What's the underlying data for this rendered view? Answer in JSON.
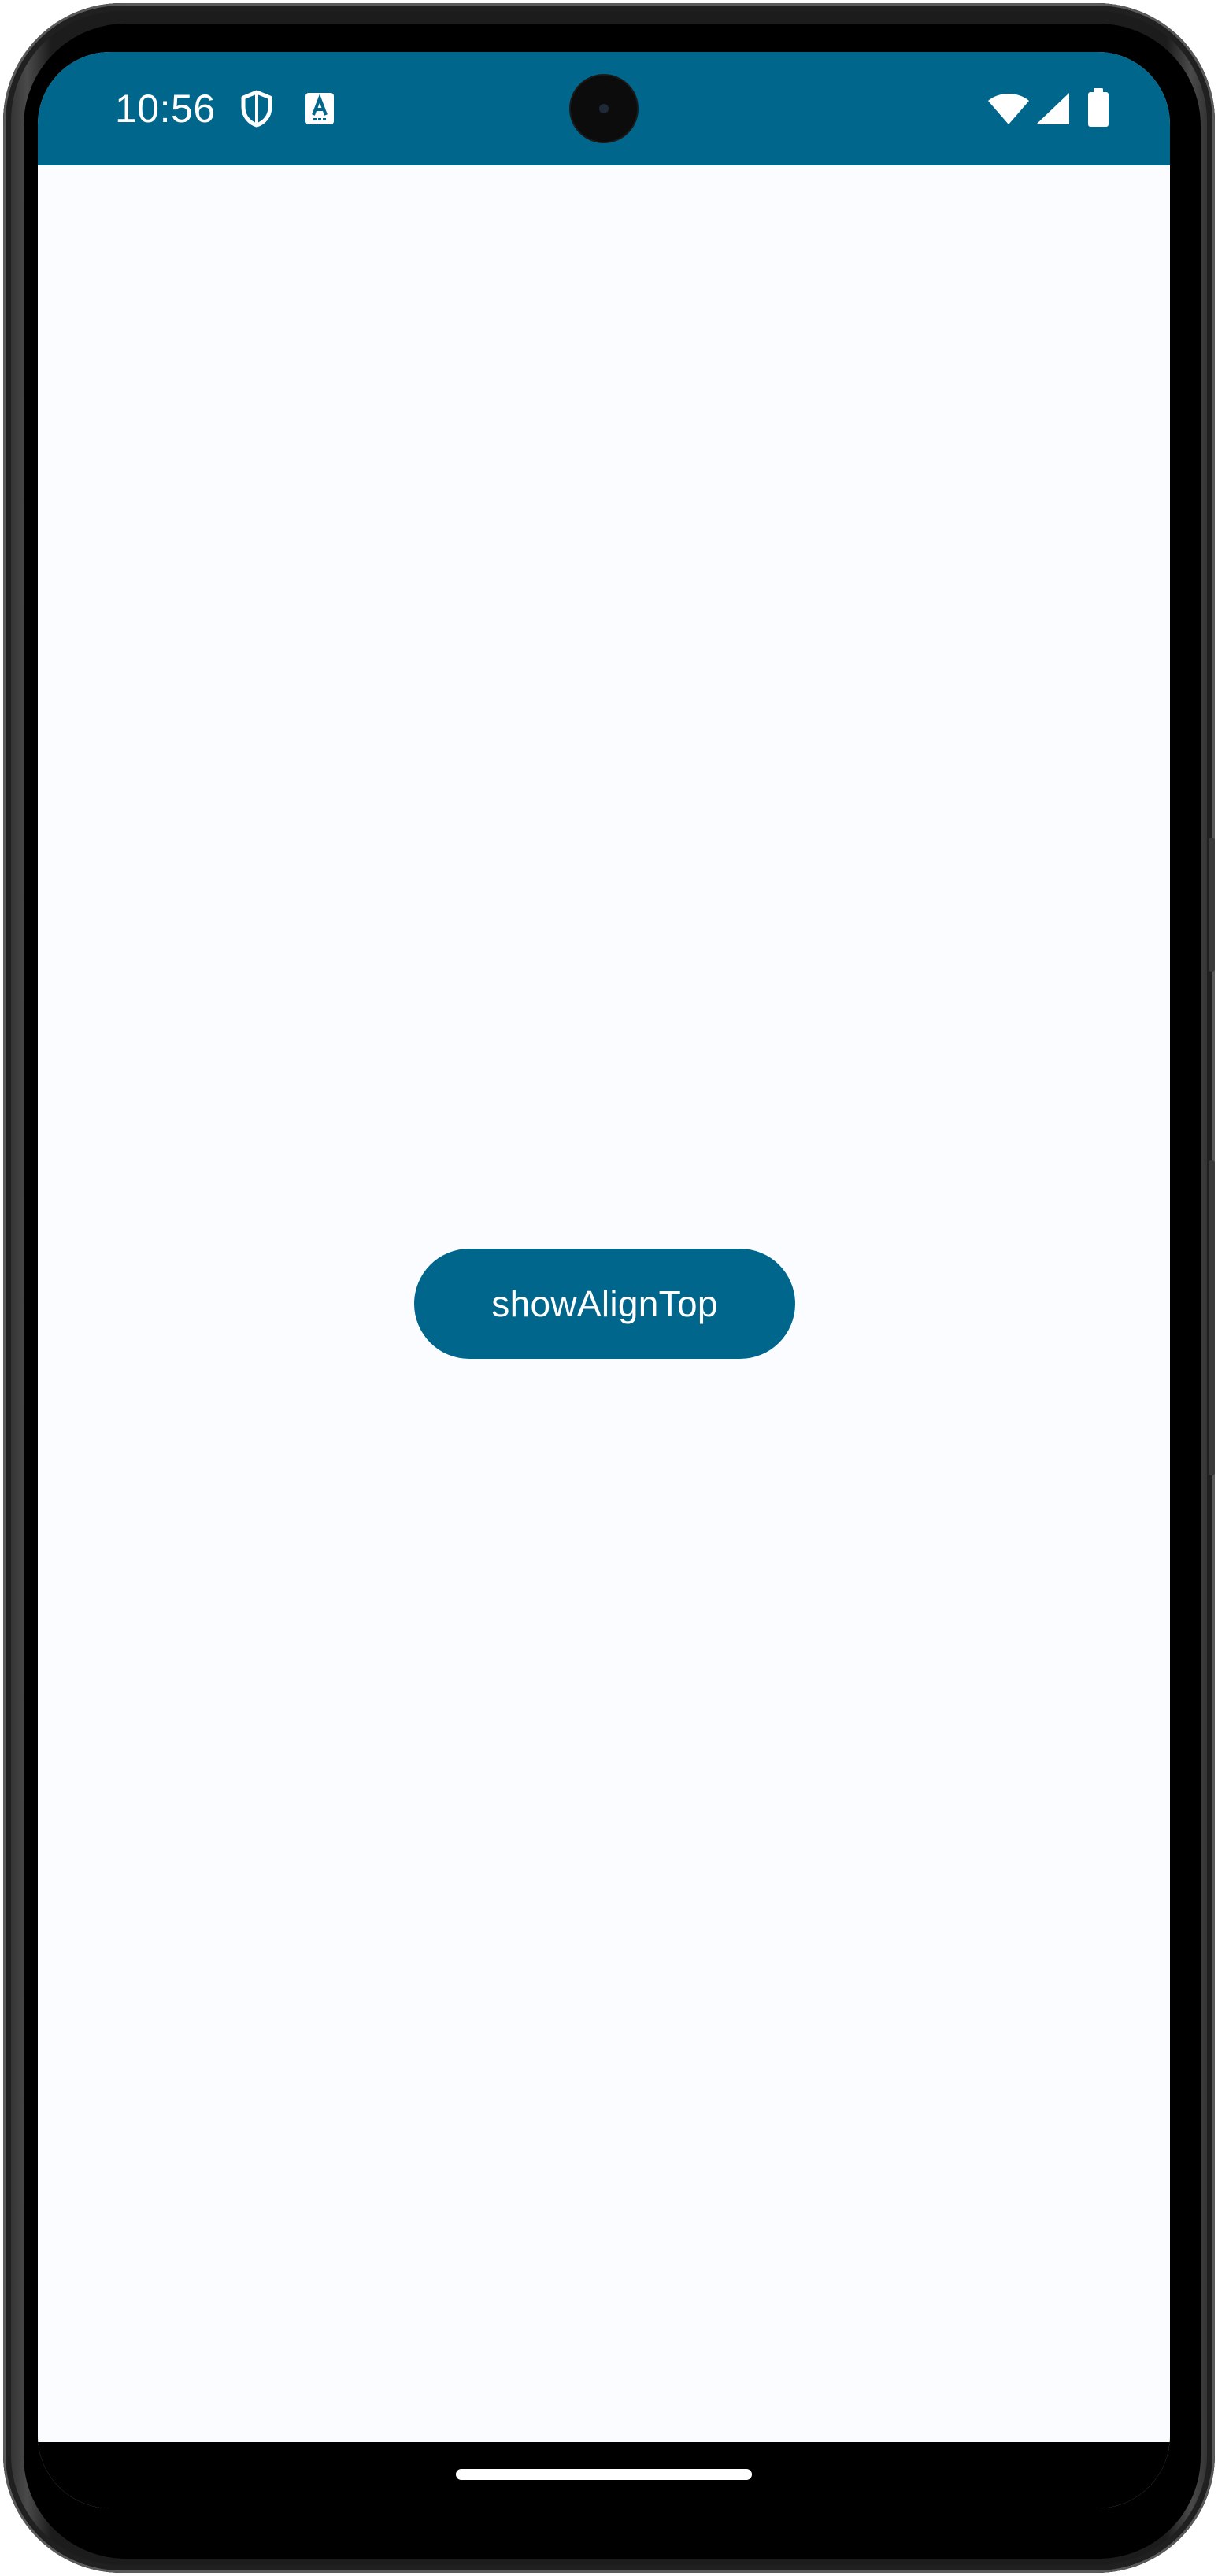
{
  "status_bar": {
    "time": "10:56",
    "background_color": "#00668b",
    "left_icons": [
      "shield-icon",
      "keyboard-a-icon"
    ],
    "right_icons": [
      "wifi-icon",
      "cellular-signal-icon",
      "battery-icon"
    ]
  },
  "main": {
    "button_label": "showAlignTop",
    "button_color": "#00668b",
    "background_color": "#fbfcff"
  }
}
